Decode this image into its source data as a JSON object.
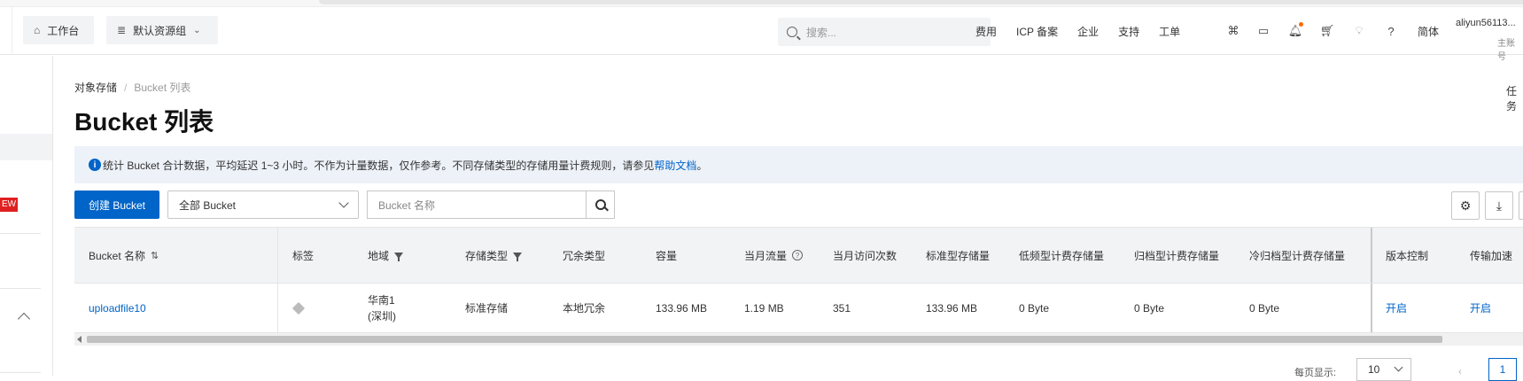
{
  "topbar": {
    "home_label": "工作台",
    "resource_group": "默认资源组",
    "search_placeholder": "搜索...",
    "links": [
      "费用",
      "ICP 备案",
      "企业",
      "支持",
      "工单"
    ],
    "lang": "简体",
    "account": "aliyun56113...",
    "account_sub": "主账号"
  },
  "sidebar": {
    "new_badge": "EW"
  },
  "breadcrumb": {
    "root": "对象存储",
    "current": "Bucket 列表"
  },
  "right_label": "任务",
  "page_title": "Bucket 列表",
  "notice": {
    "text": "统计 Bucket 合计数据，平均延迟 1~3 小时。不作为计量数据，仅作参考。不同存储类型的存储用量计费规则，请参见",
    "link": "帮助文档",
    "tail": "。"
  },
  "toolbar": {
    "create_label": "创建 Bucket",
    "bucket_filter": "全部 Bucket",
    "name_placeholder": "Bucket 名称"
  },
  "table": {
    "headers": {
      "name": "Bucket 名称",
      "tags": "标签",
      "region": "地域",
      "storage_class": "存储类型",
      "redundancy": "冗余类型",
      "capacity": "容量",
      "monthly_traffic": "当月流量",
      "monthly_requests": "当月访问次数",
      "standard_storage": "标准型存储量",
      "ia_storage": "低频型计费存储量",
      "archive_storage": "归档型计费存储量",
      "cold_archive_storage": "冷归档型计费存储量",
      "versioning": "版本控制",
      "acceleration": "传输加速"
    },
    "rows": [
      {
        "name": "uploadfile10",
        "region_line1": "华南1",
        "region_line2": "(深圳)",
        "storage_class": "标准存储",
        "redundancy": "本地冗余",
        "capacity": "133.96 MB",
        "monthly_traffic": "1.19 MB",
        "monthly_requests": "351",
        "standard_storage": "133.96 MB",
        "ia_storage": "0 Byte",
        "archive_storage": "0 Byte",
        "cold_archive_storage": "0 Byte",
        "versioning": "开启",
        "acceleration": "开启"
      }
    ]
  },
  "pagination": {
    "per_page_label": "每页显示:",
    "per_page": "10",
    "current_page": "1"
  }
}
